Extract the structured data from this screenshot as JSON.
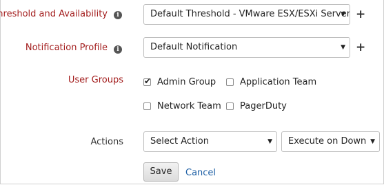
{
  "threshold": {
    "label": "Threshold and Availability",
    "info_icon": "i",
    "selected": "Default Threshold - VMware ESX/ESXi Server",
    "add_icon": "+"
  },
  "notification": {
    "label": "Notification Profile",
    "info_icon": "i",
    "selected": "Default Notification",
    "add_icon": "+"
  },
  "user_groups": {
    "label": "User Groups",
    "items": [
      {
        "label": "Admin Group",
        "checked": true
      },
      {
        "label": "Application Team",
        "checked": false
      },
      {
        "label": "Network Team",
        "checked": false
      },
      {
        "label": "PagerDuty",
        "checked": false
      }
    ]
  },
  "actions": {
    "label": "Actions",
    "action_selected": "Select Action",
    "execute_selected": "Execute on Down"
  },
  "buttons": {
    "save": "Save",
    "cancel": "Cancel"
  },
  "glyphs": {
    "caret": "▼",
    "check": "✔"
  }
}
